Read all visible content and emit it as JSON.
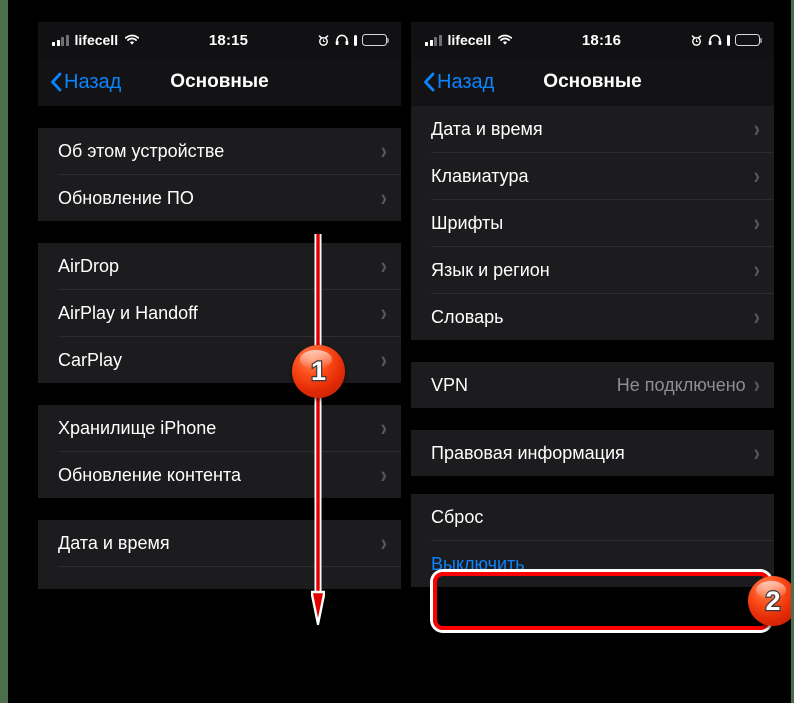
{
  "theme": {
    "background": "#000000",
    "outer_border": "#4a6f4a",
    "panel_bg": "#000000",
    "group_bg": "#1c1c1e",
    "accent_blue": "#0a84ff",
    "annotation_red": "#ff0000",
    "secondary_text": "#8e8e93"
  },
  "left_phone": {
    "status_bar": {
      "carrier": "lifecell",
      "wifi_icon": "wifi-icon",
      "signal_icon": "cellular-signal-icon",
      "time": "18:15",
      "alarm_icon": "alarm-clock-icon",
      "headphones_icon": "headphones-icon",
      "battery_icon": "battery-icon"
    },
    "nav": {
      "back_label": "Назад",
      "back_icon": "chevron-left-icon",
      "title": "Основные"
    },
    "groups": [
      {
        "rows": [
          {
            "label": "Об этом устройстве",
            "value": "",
            "chevron": "›"
          },
          {
            "label": "Обновление ПО",
            "value": "",
            "chevron": "›"
          }
        ]
      },
      {
        "rows": [
          {
            "label": "AirDrop",
            "value": "",
            "chevron": "›"
          },
          {
            "label": "AirPlay и Handoff",
            "value": "",
            "chevron": "›"
          },
          {
            "label": "CarPlay",
            "value": "",
            "chevron": "›"
          }
        ]
      },
      {
        "rows": [
          {
            "label": "Хранилище iPhone",
            "value": "",
            "chevron": "›"
          },
          {
            "label": "Обновление контента",
            "value": "",
            "chevron": "›"
          }
        ]
      },
      {
        "rows": [
          {
            "label": "Дата и время",
            "value": "",
            "chevron": "›"
          }
        ]
      }
    ]
  },
  "right_phone": {
    "status_bar": {
      "carrier": "lifecell",
      "wifi_icon": "wifi-icon",
      "signal_icon": "cellular-signal-icon",
      "time": "18:16",
      "alarm_icon": "alarm-clock-icon",
      "headphones_icon": "headphones-icon",
      "battery_icon": "battery-icon"
    },
    "nav": {
      "back_label": "Назад",
      "back_icon": "chevron-left-icon",
      "title": "Основные"
    },
    "groups": [
      {
        "rows": [
          {
            "label": "Дата и время",
            "value": "",
            "chevron": "›"
          },
          {
            "label": "Клавиатура",
            "value": "",
            "chevron": "›"
          },
          {
            "label": "Шрифты",
            "value": "",
            "chevron": "›"
          },
          {
            "label": "Язык и регион",
            "value": "",
            "chevron": "›"
          },
          {
            "label": "Словарь",
            "value": "",
            "chevron": "›"
          }
        ]
      },
      {
        "rows": [
          {
            "label": "VPN",
            "value": "Не подключено",
            "chevron": "›"
          }
        ]
      },
      {
        "rows": [
          {
            "label": "Правовая информация",
            "value": "",
            "chevron": "›"
          }
        ]
      },
      {
        "rows": [
          {
            "label": "Сброс",
            "value": "",
            "chevron": ""
          },
          {
            "label": "Выключить",
            "value": "",
            "chevron": ""
          }
        ]
      }
    ]
  },
  "annotations": {
    "step_one": "1",
    "step_two": "2",
    "arrow_icon": "down-arrow-icon",
    "highlight_icon": "red-highlight-box"
  }
}
